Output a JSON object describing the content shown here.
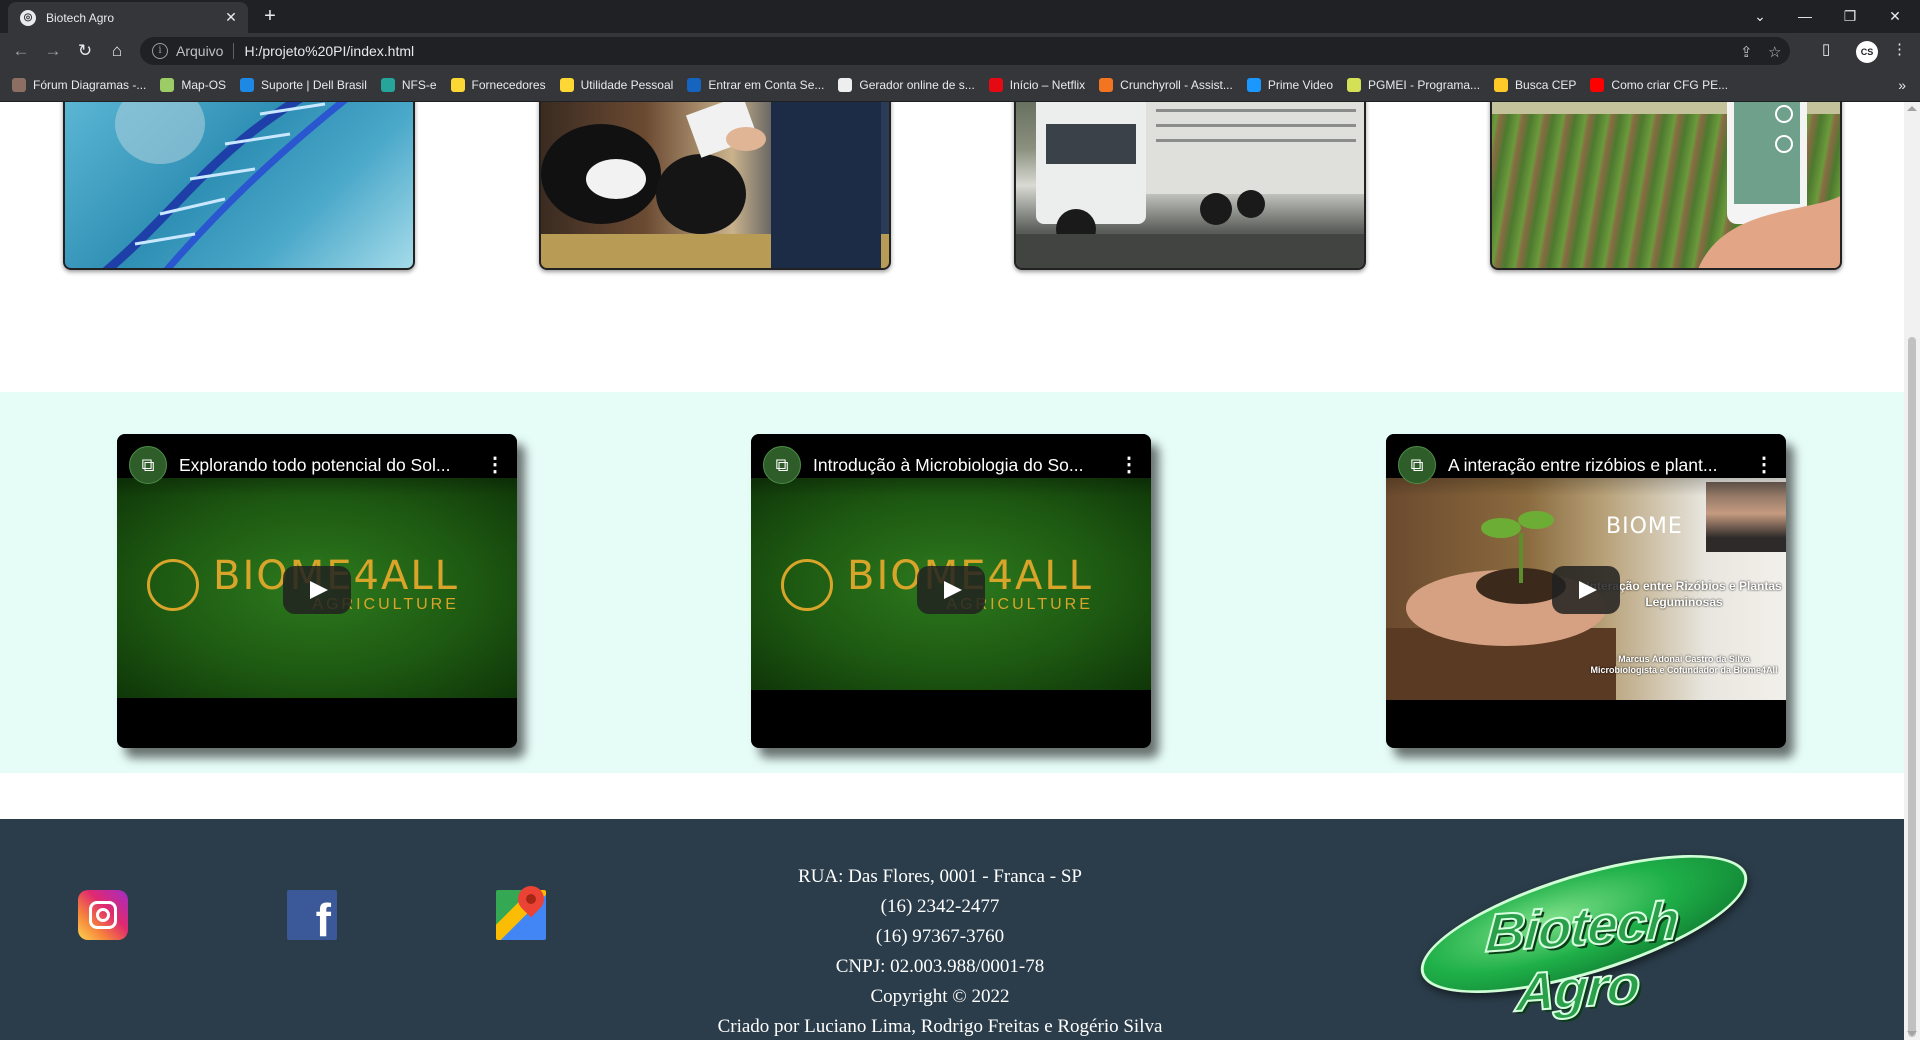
{
  "browser": {
    "tab_title": "Biotech Agro",
    "tab_favicon": "globe-icon",
    "new_tab": "+",
    "omnibox_label": "Arquivo",
    "url": "H:/projeto%20PI/index.html",
    "bookmarks": [
      {
        "label": "Fórum Diagramas -...",
        "color": "#8d6e63"
      },
      {
        "label": "Map-OS",
        "color": "#9ccc65"
      },
      {
        "label": "Suporte | Dell Brasil",
        "color": "#1e88e5"
      },
      {
        "label": "NFS-e",
        "color": "#26a69a"
      },
      {
        "label": "Fornecedores",
        "color": "#fdd835"
      },
      {
        "label": "Utilidade Pessoal",
        "color": "#fdd835"
      },
      {
        "label": "Entrar em Conta Se...",
        "color": "#1565c0"
      },
      {
        "label": "Gerador online de s...",
        "color": "#eeeeee"
      },
      {
        "label": "Início – Netflix",
        "color": "#e50914"
      },
      {
        "label": "Crunchyroll - Assist...",
        "color": "#f47521"
      },
      {
        "label": "Prime Video",
        "color": "#1a98ff"
      },
      {
        "label": "PGMEI - Programa...",
        "color": "#d4e157"
      },
      {
        "label": "Busca CEP",
        "color": "#ffca28"
      },
      {
        "label": "Como criar CFG PE...",
        "color": "#ff0000"
      }
    ],
    "more_bookmarks": "»"
  },
  "cards": [
    {
      "name": "dna-image"
    },
    {
      "name": "cattle-veterinarian-image"
    },
    {
      "name": "livestock-truck-image"
    },
    {
      "name": "smart-farming-image"
    }
  ],
  "videos": [
    {
      "title": "Explorando todo potencial do Sol...",
      "brand_word": "BIOME4ALL",
      "brand_sub": "AGRICULTURE"
    },
    {
      "title": "Introdução à Microbiologia do So...",
      "brand_word": "BIOME4ALL",
      "brand_sub": "AGRICULTURE"
    },
    {
      "title": "A interação entre rizóbios e plant...",
      "brand_word": "BIOME",
      "overlay_title": "Interação entre Rizóbios e Plantas Leguminosas",
      "overlay_author": "Marcus Adonai Castro da Silva Microbiologista e Cofundador da Biome4All"
    }
  ],
  "footer": {
    "address": "RUA: Das Flores, 0001 - Franca - SP",
    "phone1": "(16) 2342-2477",
    "phone2": "(16) 97367-3760",
    "cnpj": "CNPJ: 02.003.988/0001-78",
    "copyright": "Copyright © 2022",
    "credits": "Criado por Luciano Lima, Rodrigo Freitas e Rogério Silva",
    "logo_text": "Biotech Agro"
  }
}
